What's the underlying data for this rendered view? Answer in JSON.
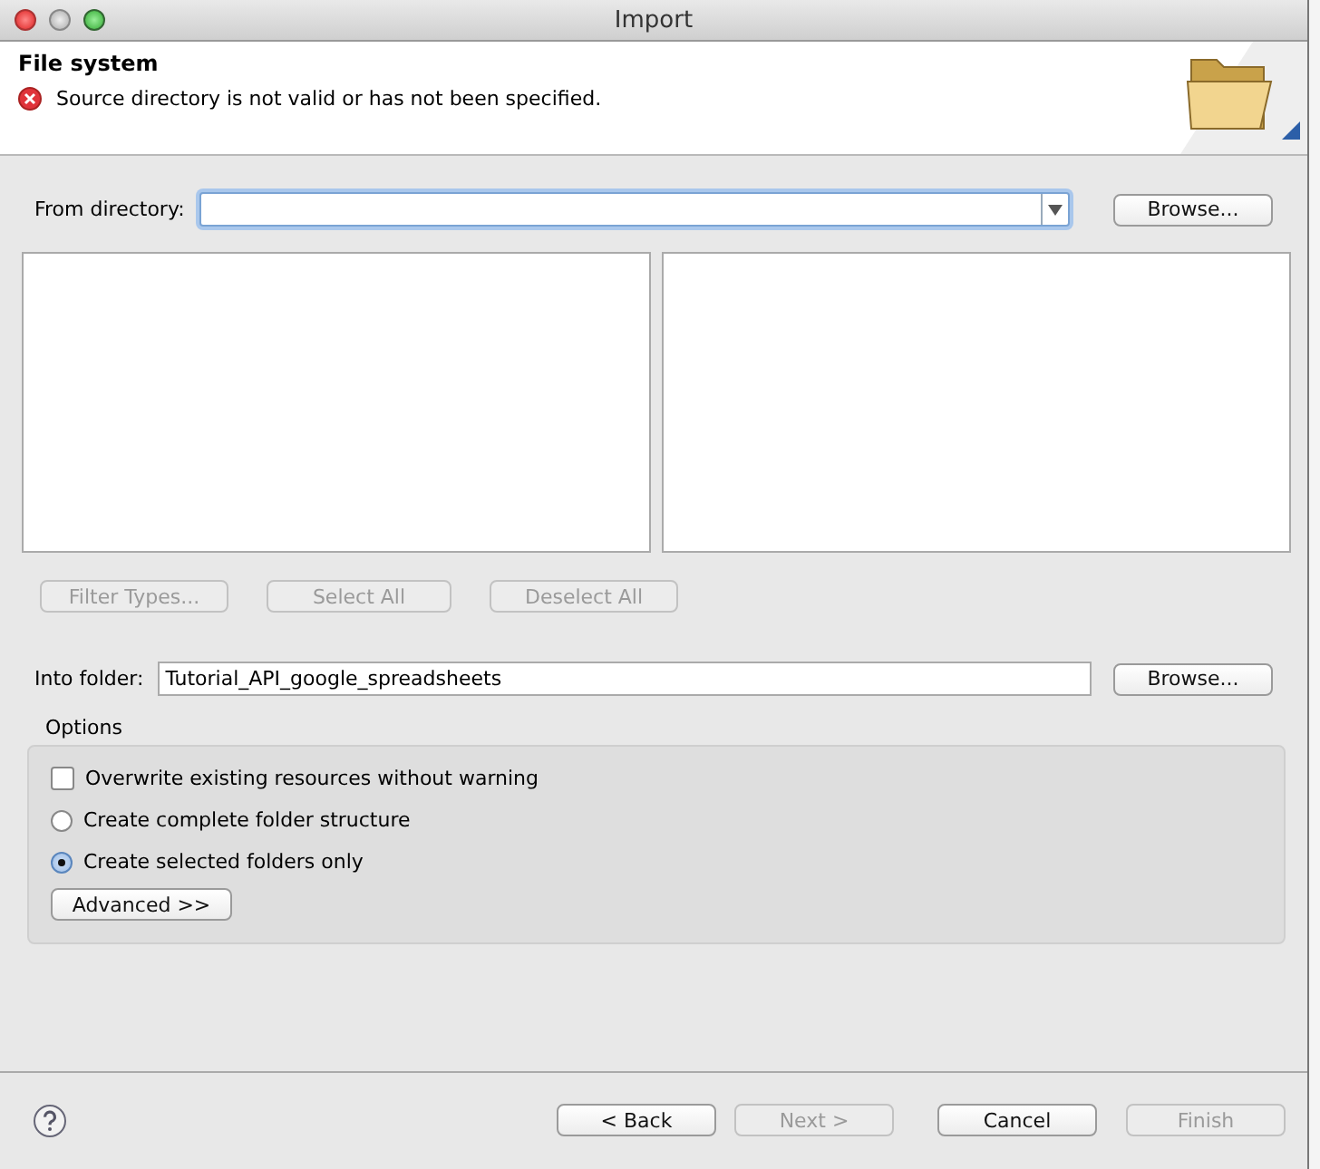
{
  "window": {
    "title": "Import"
  },
  "header": {
    "title": "File system",
    "message": "Source directory is not valid or has not been specified."
  },
  "from_directory": {
    "label": "From directory:",
    "browse_button": "Browse..."
  },
  "list_buttons": [
    {
      "label": "Filter Types...",
      "disabled": true
    },
    {
      "label": "Select All",
      "disabled": true
    },
    {
      "label": "Deselect All",
      "disabled": true
    }
  ],
  "into_folder": {
    "label": "Into folder:",
    "value": "Tutorial_API_google_spreadsheets",
    "browse_button": "Browse..."
  },
  "options": {
    "title": "Options",
    "items": [
      {
        "kind": "checkbox",
        "label": "Overwrite existing resources without warning",
        "checked": false
      },
      {
        "kind": "radio",
        "label": "Create complete folder structure",
        "selected": false
      },
      {
        "kind": "radio",
        "label": "Create selected folders only",
        "selected": true
      }
    ],
    "advanced_button": "Advanced >>"
  },
  "footer_buttons": [
    {
      "label": "< Back",
      "disabled": false
    },
    {
      "label": "Next >",
      "disabled": true
    },
    {
      "label": "Cancel",
      "disabled": false
    },
    {
      "label": "Finish",
      "disabled": true
    }
  ]
}
